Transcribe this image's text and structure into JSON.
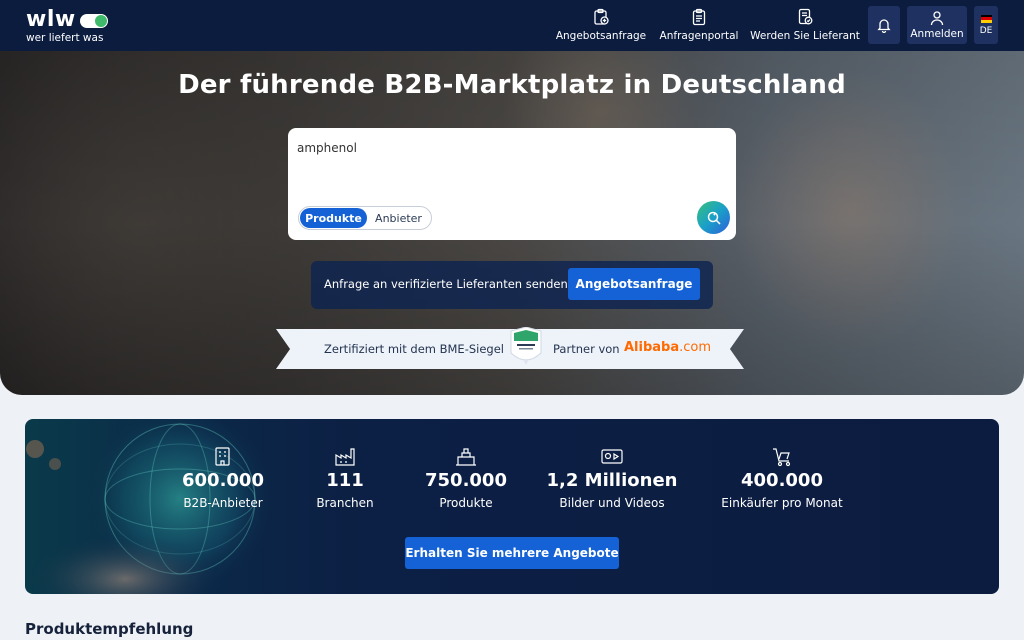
{
  "header": {
    "logo_word": "wlw",
    "logo_tagline": "wer liefert was",
    "nav": [
      {
        "label": "Angebotsanfrage",
        "icon": "clipboard-add-icon"
      },
      {
        "label": "Anfragenportal",
        "icon": "clipboard-list-icon"
      },
      {
        "label": "Werden Sie Lieferant",
        "icon": "document-badge-icon"
      }
    ],
    "bell_icon": "bell-icon",
    "login_label": "Anmelden",
    "login_icon": "user-icon",
    "language": "DE"
  },
  "hero": {
    "title": "Der führende B2B-Marktplatz in Deutschland",
    "search_value": "amphenol",
    "segments": [
      "Produkte",
      "Anbieter"
    ],
    "active_segment": "Produkte",
    "search_button_icon": "sparkle-search-icon",
    "inquiry_text": "Anfrage an verifizierte Lieferanten senden.",
    "inquiry_button": "Angebotsanfrage",
    "bme_text": "Zertifiziert mit dem BME-Siegel",
    "partner_text": "Partner von",
    "alibaba_brand": "Alibaba",
    "alibaba_suffix": ".com"
  },
  "stats": {
    "items": [
      {
        "value": "600.000",
        "label": "B2B-Anbieter",
        "icon": "building-badge-icon"
      },
      {
        "value": "111",
        "label": "Branchen",
        "icon": "factory-icon"
      },
      {
        "value": "750.000",
        "label": "Produkte",
        "icon": "product-crate-icon"
      },
      {
        "value": "1,2 Millionen",
        "label": "Bilder und Videos",
        "icon": "media-icon"
      },
      {
        "value": "400.000",
        "label": "Einkäufer pro Monat",
        "icon": "cart-icon"
      }
    ],
    "cta": "Erhalten Sie mehrere Angebote"
  },
  "section_title": "Produktempfehlung",
  "colors": {
    "header_bg": "#0b1c3f",
    "primary": "#1562d6",
    "alibaba": "#ff6a00",
    "page_bg": "#eef1f5"
  }
}
